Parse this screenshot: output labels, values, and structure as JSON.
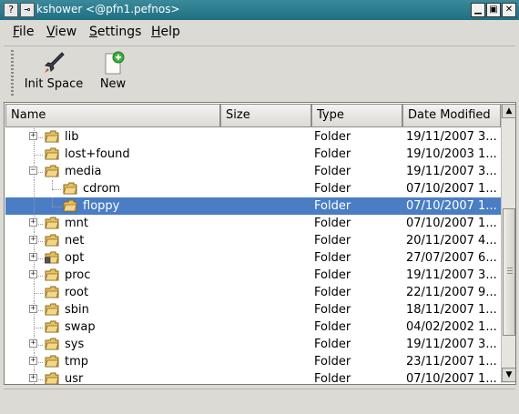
{
  "window": {
    "icon_help": "?",
    "icon_pin": "⊸",
    "title": "kshower <@pfn1.pefnos>",
    "controls": [
      "▁",
      "▣",
      "✕"
    ]
  },
  "menu": [
    {
      "key": "F",
      "rest": "ile"
    },
    {
      "key": "V",
      "rest": "iew"
    },
    {
      "key": "S",
      "rest": "ettings"
    },
    {
      "key": "H",
      "rest": "elp"
    }
  ],
  "toolbar": {
    "init_space_label": "Init Space",
    "new_label": "New"
  },
  "columns": [
    "Name",
    "Size",
    "Type",
    "Date Modified"
  ],
  "rows": [
    {
      "name": "lib",
      "type": "Folder",
      "date": "19/11/2007 3...",
      "expander": "+",
      "depth": 0,
      "selected": false
    },
    {
      "name": "lost+found",
      "type": "Folder",
      "date": "19/10/2003 1...",
      "expander": "",
      "depth": 0,
      "selected": false
    },
    {
      "name": "media",
      "type": "Folder",
      "date": "19/11/2007 3...",
      "expander": "−",
      "depth": 0,
      "selected": false
    },
    {
      "name": "cdrom",
      "type": "Folder",
      "date": "07/10/2007 1...",
      "expander": "",
      "depth": 1,
      "selected": false
    },
    {
      "name": "floppy",
      "type": "Folder",
      "date": "07/10/2007 1...",
      "expander": "",
      "depth": 1,
      "selected": true
    },
    {
      "name": "mnt",
      "type": "Folder",
      "date": "07/10/2007 1...",
      "expander": "+",
      "depth": 0,
      "selected": false
    },
    {
      "name": "net",
      "type": "Folder",
      "date": "20/11/2007 4...",
      "expander": "+",
      "depth": 0,
      "selected": false
    },
    {
      "name": "opt",
      "type": "Folder",
      "date": "27/07/2007 6...",
      "expander": "+",
      "depth": 0,
      "selected": false,
      "locked": true
    },
    {
      "name": "proc",
      "type": "Folder",
      "date": "19/11/2007 3...",
      "expander": "+",
      "depth": 0,
      "selected": false
    },
    {
      "name": "root",
      "type": "Folder",
      "date": "22/11/2007 9...",
      "expander": "",
      "depth": 0,
      "selected": false
    },
    {
      "name": "sbin",
      "type": "Folder",
      "date": "18/11/2007 1...",
      "expander": "+",
      "depth": 0,
      "selected": false
    },
    {
      "name": "swap",
      "type": "Folder",
      "date": "04/02/2002 1...",
      "expander": "",
      "depth": 0,
      "selected": false
    },
    {
      "name": "sys",
      "type": "Folder",
      "date": "19/11/2007 3...",
      "expander": "+",
      "depth": 0,
      "selected": false
    },
    {
      "name": "tmp",
      "type": "Folder",
      "date": "23/11/2007 1...",
      "expander": "+",
      "depth": 0,
      "selected": false
    },
    {
      "name": "usr",
      "type": "Folder",
      "date": "07/10/2007 1...",
      "expander": "+",
      "depth": 0,
      "selected": false
    }
  ],
  "colors": {
    "selection": "#4a7dc4",
    "titlebar": "#1f6f82",
    "folder": "#e8c060"
  },
  "scrollbar": {
    "up": "▲",
    "down": "▼"
  }
}
